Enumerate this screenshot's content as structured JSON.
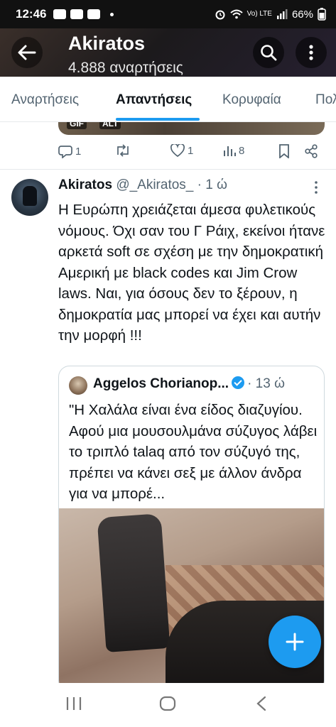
{
  "status_bar": {
    "time": "12:46",
    "network": "Vo) LTE",
    "battery": "66%"
  },
  "header": {
    "title": "Akiratos",
    "subtitle": "4.888 αναρτήσεις"
  },
  "tabs": [
    {
      "label": "Αναρτήσεις",
      "active": false
    },
    {
      "label": "Απαντήσεις",
      "active": true
    },
    {
      "label": "Κορυφαία",
      "active": false
    },
    {
      "label": "Πολ",
      "active": false
    }
  ],
  "previous_tweet": {
    "media_badges": [
      "GIF",
      "ALT"
    ],
    "replies": "1",
    "likes": "1",
    "views": "8"
  },
  "tweet": {
    "name": "Akiratos",
    "handle": "@_Akiratos_",
    "time": "· 1 ώ",
    "text": "Η Ευρώπη χρειάζεται άμεσα φυλετικούς νόμους. Όχι σαν του Γ Ράιχ, εκείνοι ήτανε αρκετά soft σε σχέση με την δημοκρατική Αμερική με black codes και Jim Crow laws. Ναι, για όσους δεν το ξέρουν, η δημοκρατία μας μπορεί να έχει και αυτήν την μορφή !!!"
  },
  "quote": {
    "name": "Aggelos Chorianop...",
    "time": "· 13 ώ",
    "text": "\"Η Χαλάλα είναι ένα είδος διαζυγίου. Αφού μια μουσουλμάνα σύζυγος λάβει το τριπλό talaq από τον σύζυγό της, πρέπει να κάνει σεξ με άλλον άνδρα για να μπορέ..."
  },
  "icons": {
    "back": "arrow-left-icon",
    "search": "search-icon",
    "more": "more-vertical-icon",
    "compose": "plus-icon"
  },
  "colors": {
    "accent": "#1d9bf0",
    "text": "#0f1419",
    "muted": "#536471"
  }
}
